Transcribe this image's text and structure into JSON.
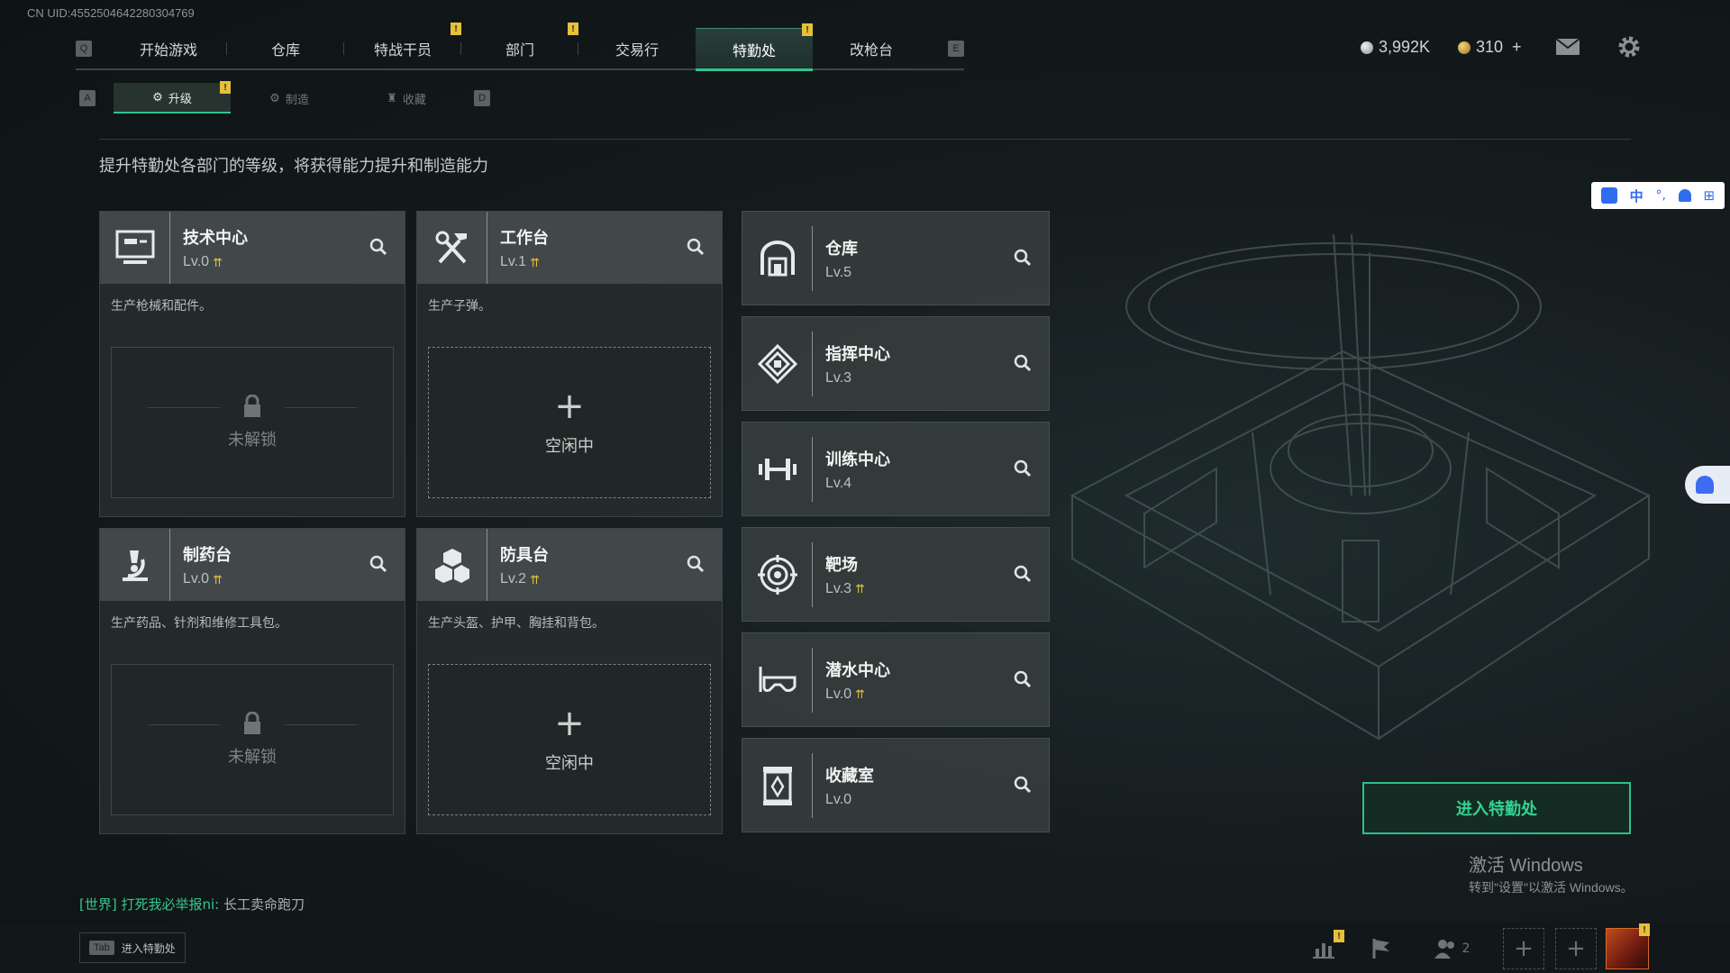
{
  "uid": "CN UID:4552504642280304769",
  "topnav": {
    "left_key": "Q",
    "right_key": "E",
    "tabs": [
      {
        "label": "开始游戏",
        "active": false,
        "alert": false
      },
      {
        "label": "仓库",
        "active": false,
        "alert": false
      },
      {
        "label": "特战干员",
        "active": false,
        "alert": true
      },
      {
        "label": "部门",
        "active": false,
        "alert": true
      },
      {
        "label": "交易行",
        "active": false,
        "alert": false
      },
      {
        "label": "特勤处",
        "active": true,
        "alert": true
      },
      {
        "label": "改枪台",
        "active": false,
        "alert": false
      }
    ],
    "alert_mark": "!"
  },
  "currency": {
    "silver": "3,992K",
    "gold": "310",
    "gold_add": "+",
    "silver_color": "#c0c4c4",
    "gold_color": "#d8aa4a"
  },
  "subnav": {
    "left_key": "A",
    "right_key": "D",
    "tabs": [
      {
        "label": "升级",
        "icon": "upgrade-icon"
      },
      {
        "label": "制造",
        "icon": "craft-icon"
      },
      {
        "label": "收藏",
        "icon": "collection-icon"
      }
    ]
  },
  "hint": "提升特勤处各部门的等级，将获得能力提升和制造能力",
  "big_cards": [
    {
      "title": "技术中心",
      "level": "Lv.0",
      "desc": "生产枪械和配件。",
      "slot": "未解锁",
      "icon": "computer-icon"
    },
    {
      "title": "工作台",
      "level": "Lv.1",
      "desc": "生产子弹。",
      "slot": "空闲中",
      "icon": "tools-icon"
    },
    {
      "title": "制药台",
      "level": "Lv.0",
      "desc": "生产药品、针剂和维修工具包。",
      "slot": "未解锁",
      "icon": "microscope-icon"
    },
    {
      "title": "防具台",
      "level": "Lv.2",
      "desc": "生产头盔、护甲、胸挂和背包。",
      "slot": "空闲中",
      "icon": "boxes-icon"
    }
  ],
  "small_cards": [
    {
      "title": "仓库",
      "level": "Lv.5",
      "upgradable": false,
      "icon": "warehouse-icon"
    },
    {
      "title": "指挥中心",
      "level": "Lv.3",
      "upgradable": false,
      "icon": "command-icon"
    },
    {
      "title": "训练中心",
      "level": "Lv.4",
      "upgradable": false,
      "icon": "dumbbell-icon"
    },
    {
      "title": "靶场",
      "level": "Lv.3",
      "upgradable": true,
      "icon": "target-icon"
    },
    {
      "title": "潜水中心",
      "level": "Lv.0",
      "upgradable": true,
      "icon": "diving-mask-icon"
    },
    {
      "title": "收藏室",
      "level": "Lv.0",
      "upgradable": false,
      "icon": "trophy-case-icon"
    }
  ],
  "enter_button": "进入特勤处",
  "windows": {
    "line1": "激活 Windows",
    "line2": "转到\"设置\"以激活 Windows。"
  },
  "chat": {
    "channel": "[世界]",
    "sender": "打死我必举报ni:",
    "message": "长工卖命跑刀"
  },
  "bottom": {
    "tab_key": "Tab",
    "tab_label": "进入特勤处",
    "friends_count": "2"
  },
  "ime": {
    "mode": "中"
  },
  "accent_color": "#31c48b",
  "alert_color": "#e6c03a"
}
